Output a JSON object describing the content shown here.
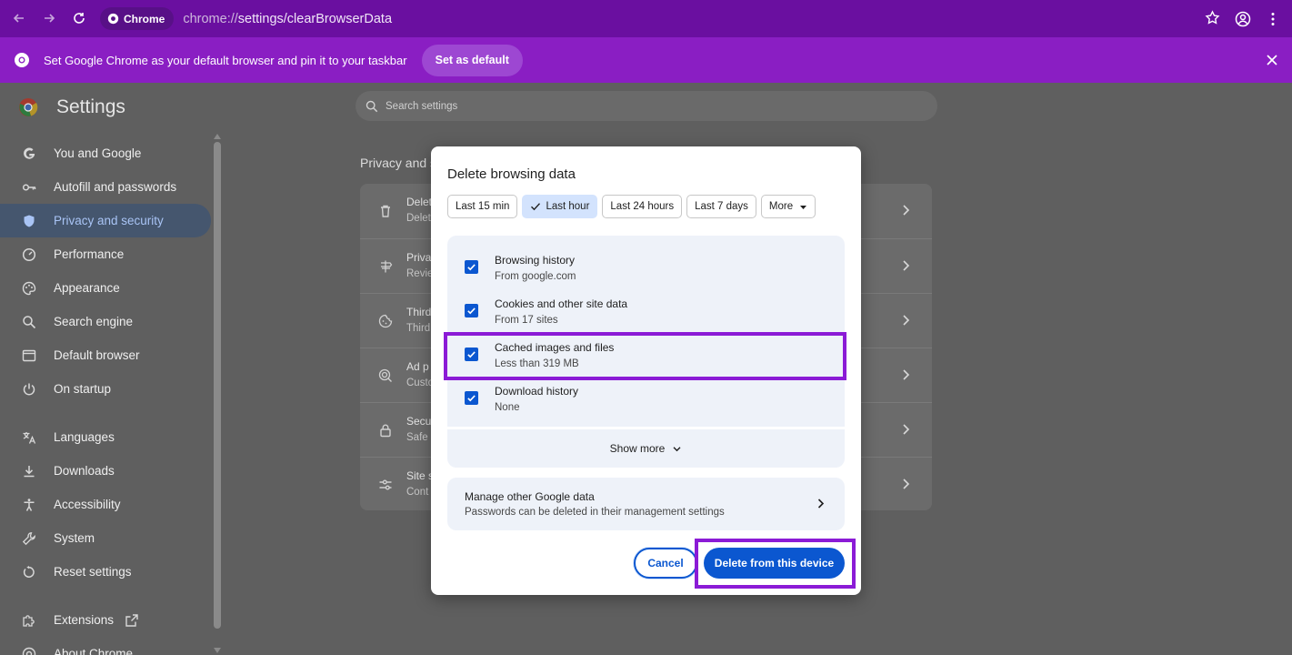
{
  "browser": {
    "chip_label": "Chrome",
    "url_scheme": "chrome://",
    "url_path": "settings/clearBrowserData"
  },
  "infobar": {
    "message": "Set Google Chrome as your default browser and pin it to your taskbar",
    "button_label": "Set as default"
  },
  "sidebar": {
    "title": "Settings",
    "items": [
      {
        "label": "You and Google",
        "icon": "google-g-icon"
      },
      {
        "label": "Autofill and passwords",
        "icon": "key-icon"
      },
      {
        "label": "Privacy and security",
        "icon": "shield-icon"
      },
      {
        "label": "Performance",
        "icon": "speedometer-icon"
      },
      {
        "label": "Appearance",
        "icon": "palette-icon"
      },
      {
        "label": "Search engine",
        "icon": "search-icon"
      },
      {
        "label": "Default browser",
        "icon": "browser-window-icon"
      },
      {
        "label": "On startup",
        "icon": "power-icon"
      },
      {
        "label": "Languages",
        "icon": "translate-icon"
      },
      {
        "label": "Downloads",
        "icon": "download-icon"
      },
      {
        "label": "Accessibility",
        "icon": "accessibility-icon"
      },
      {
        "label": "System",
        "icon": "wrench-icon"
      },
      {
        "label": "Reset settings",
        "icon": "reset-icon"
      },
      {
        "label": "Extensions",
        "icon": "puzzle-icon"
      },
      {
        "label": "About Chrome",
        "icon": "chrome-icon"
      }
    ]
  },
  "search": {
    "placeholder": "Search settings"
  },
  "main": {
    "section_title": "Privacy and s",
    "rows": [
      {
        "title": "Delet",
        "sub": "Delet",
        "icon": "trash-icon"
      },
      {
        "title": "Priva",
        "sub": "Revie",
        "icon": "compass-icon"
      },
      {
        "title": "Third",
        "sub": "Third",
        "icon": "cookie-icon"
      },
      {
        "title": "Ad p",
        "sub": "Custo",
        "icon": "ad-privacy-icon"
      },
      {
        "title": "Secu",
        "sub": "Safe",
        "icon": "lock-icon"
      },
      {
        "title": "Site s",
        "sub": "Cont",
        "icon": "sliders-icon"
      }
    ]
  },
  "dialog": {
    "title": "Delete browsing data",
    "time_ranges": [
      "Last 15 min",
      "Last hour",
      "Last 24 hours",
      "Last 7 days",
      "More"
    ],
    "selected_time_range": "Last hour",
    "items": [
      {
        "label": "Browsing history",
        "detail": "From google.com",
        "checked": true
      },
      {
        "label": "Cookies and other site data",
        "detail": "From 17 sites",
        "checked": true
      },
      {
        "label": "Cached images and files",
        "detail": "Less than 319 MB",
        "checked": true
      },
      {
        "label": "Download history",
        "detail": "None",
        "checked": true
      }
    ],
    "show_more_label": "Show more",
    "manage_title": "Manage other Google data",
    "manage_subtitle": "Passwords can be deleted in their management settings",
    "cancel_label": "Cancel",
    "delete_label": "Delete from this device"
  },
  "colors": {
    "frame": "#6a0fa0",
    "infobar": "#8a1ec3",
    "accent": "#0b57d0",
    "highlight": "#8b1bd6"
  }
}
